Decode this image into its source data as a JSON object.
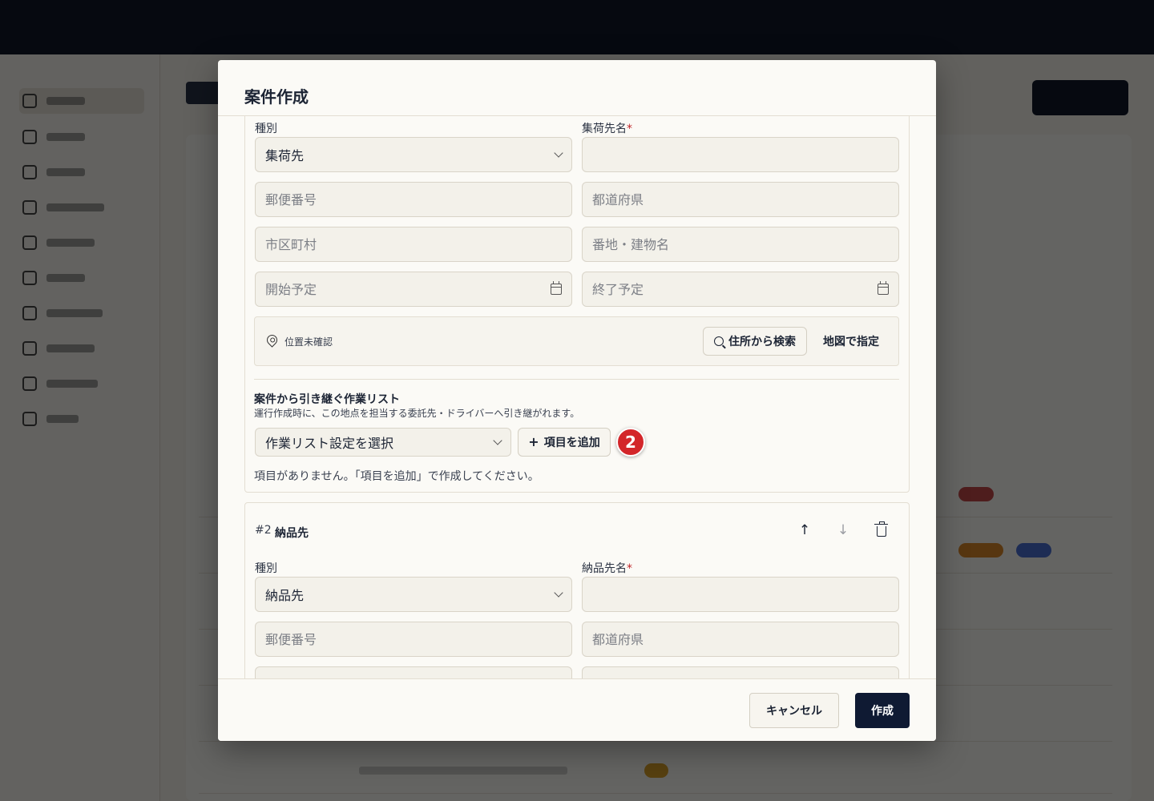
{
  "modal": {
    "title": "案件作成",
    "pickup": {
      "type_label": "種別",
      "type_value": "集荷先",
      "name_label": "集荷先名",
      "required_mark": "*",
      "postal_placeholder": "郵便番号",
      "prefecture_placeholder": "都道府県",
      "city_placeholder": "市区町村",
      "address_placeholder": "番地・建物名",
      "start_placeholder": "開始予定",
      "end_placeholder": "終了予定",
      "location_status": "位置未確認",
      "search_by_address": "住所から検索",
      "pick_on_map": "地図で指定",
      "worklist_title": "案件から引き継ぐ作業リスト",
      "worklist_desc": "運行作成時に、この地点を担当する委託先・ドライバーへ引き継がれます。",
      "worklist_select": "作業リスト設定を選択",
      "add_item": "項目を追加",
      "step_badge": "2",
      "empty_message": "項目がありません。「項目を追加」で作成してください。"
    },
    "delivery": {
      "number": "#2",
      "title": "納品先",
      "type_label": "種別",
      "type_value": "納品先",
      "name_label": "納品先名",
      "required_mark": "*",
      "postal_placeholder": "郵便番号",
      "prefecture_placeholder": "都道府県"
    },
    "footer": {
      "cancel": "キャンセル",
      "create": "作成"
    }
  }
}
